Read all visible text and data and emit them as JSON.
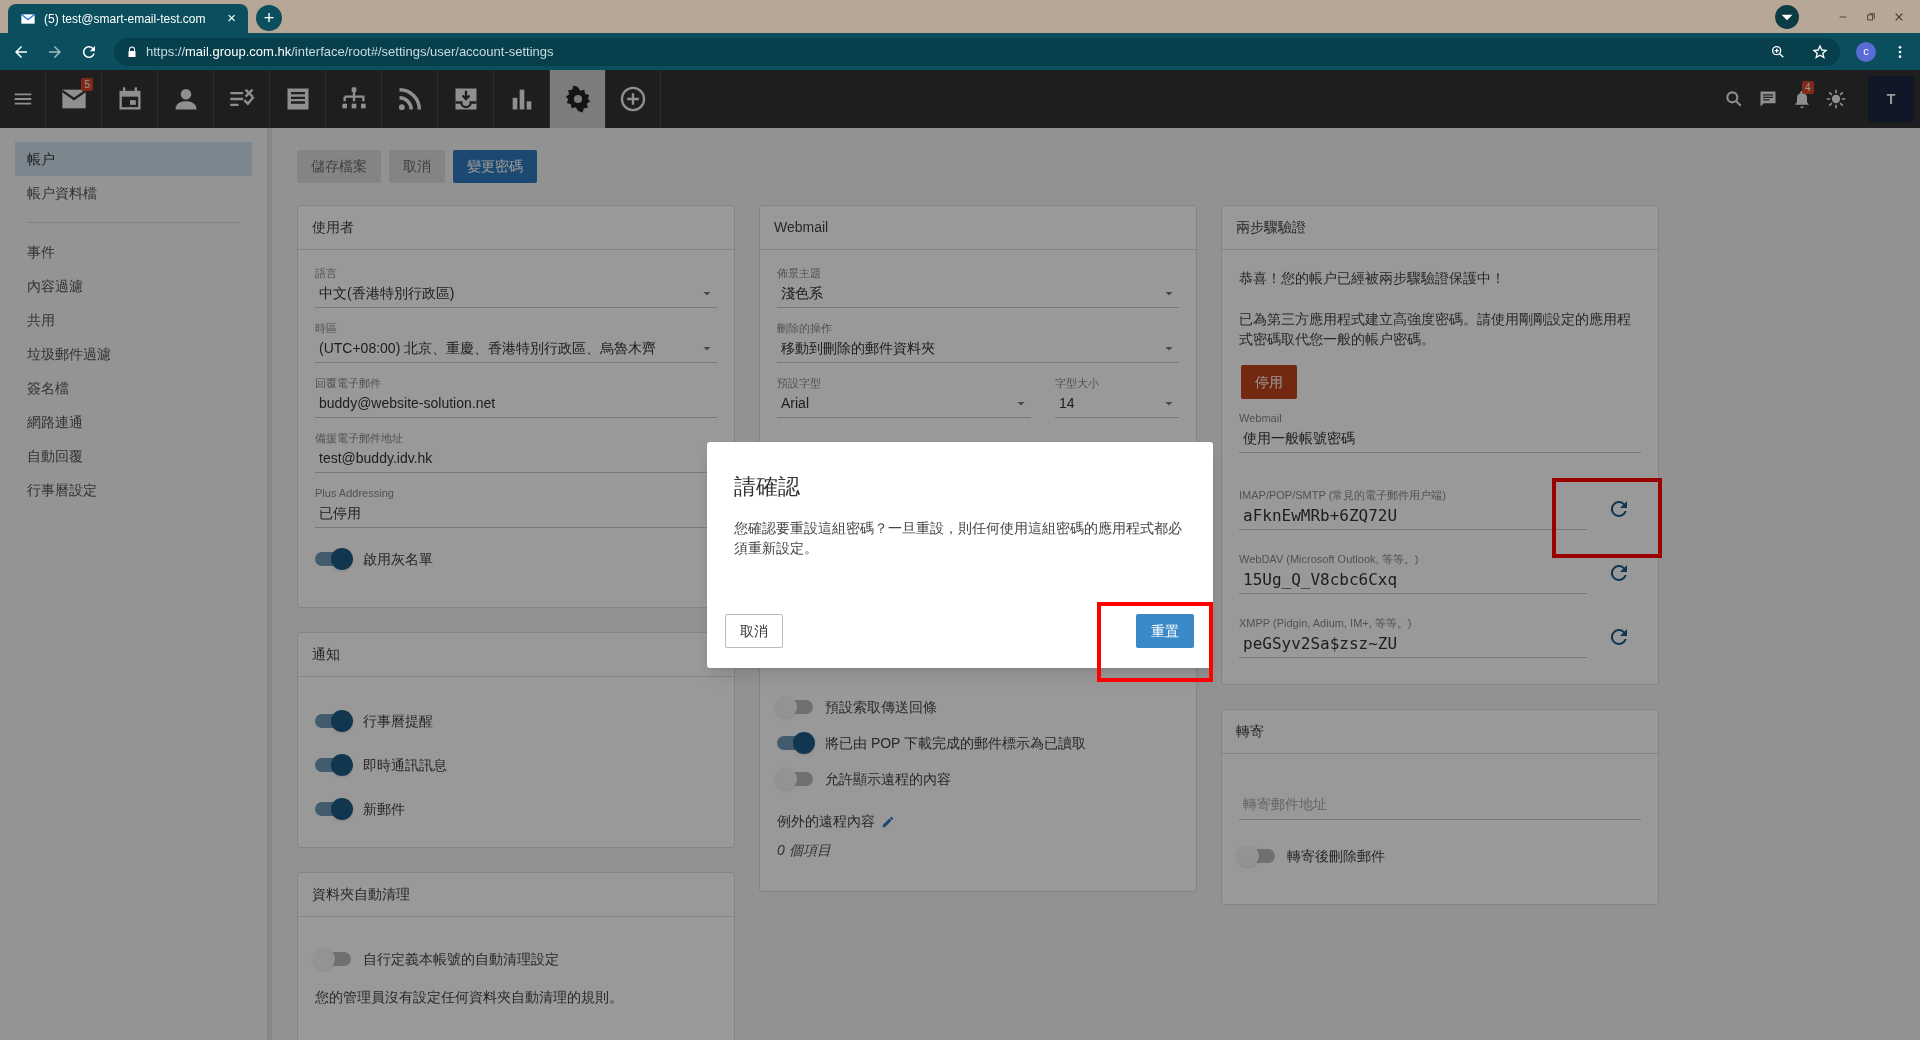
{
  "browser": {
    "tab_title": "(5) test@smart-email-test.com",
    "tab_close": "×",
    "new_tab": "+",
    "url_scheme": "https://",
    "url_host": "mail.group.com.hk",
    "url_path": "/interface/root#/settings/user/account-settings",
    "profile": "c"
  },
  "toolbar": {
    "apps": [
      {
        "kind": "mail",
        "selected": false,
        "badge": "5"
      },
      {
        "kind": "calendar",
        "selected": false
      },
      {
        "kind": "contacts",
        "selected": false
      },
      {
        "kind": "tasks",
        "selected": false
      },
      {
        "kind": "notes",
        "selected": false
      },
      {
        "kind": "org",
        "selected": false
      },
      {
        "kind": "rss",
        "selected": false
      },
      {
        "kind": "archive",
        "selected": false
      },
      {
        "kind": "reports",
        "selected": false
      },
      {
        "kind": "settings",
        "selected": true
      },
      {
        "kind": "add",
        "selected": false
      }
    ],
    "notifications_badge": "4",
    "avatar": "T"
  },
  "sidebar": {
    "groups": [
      [
        {
          "label": "帳户",
          "selected": true
        },
        {
          "label": "帳户資料檔",
          "selected": false
        }
      ],
      [
        {
          "label": "事件",
          "selected": false
        },
        {
          "label": "內容過濾",
          "selected": false
        },
        {
          "label": "共用",
          "selected": false
        },
        {
          "label": "垃圾郵件過濾",
          "selected": false
        },
        {
          "label": "簽名檔",
          "selected": false
        },
        {
          "label": "網路連通",
          "selected": false
        },
        {
          "label": "自動回覆",
          "selected": false
        },
        {
          "label": "行事曆設定",
          "selected": false
        }
      ]
    ]
  },
  "actions": [
    {
      "label": "儲存檔案",
      "disabled": true
    },
    {
      "label": "取消",
      "disabled": true
    },
    {
      "label": "變更密碼",
      "disabled": false
    }
  ],
  "user_card": {
    "title": "使用者",
    "fields": [
      {
        "kind": "select",
        "label": "語言",
        "value": "中文(香港特別行政區)"
      },
      {
        "kind": "select",
        "label": "時區",
        "value": "(UTC+08:00) 北京、重慶、香港特別行政區、烏魯木齊"
      },
      {
        "kind": "text",
        "label": "回覆電子郵件",
        "value": "buddy@website-solution.net"
      },
      {
        "kind": "text",
        "label": "備援電子郵件地址",
        "value": "test@buddy.idv.hk"
      },
      {
        "kind": "text",
        "label": "Plus Addressing",
        "value": "已停用"
      }
    ],
    "toggles": [
      {
        "label": "啟用灰名單",
        "on": true
      }
    ]
  },
  "notify_card": {
    "title": "通知",
    "toggles": [
      {
        "label": "行事曆提醒",
        "on": true
      },
      {
        "label": "即時通訊訊息",
        "on": true
      },
      {
        "label": "新郵件",
        "on": true
      }
    ]
  },
  "cleanup_card": {
    "title": "資料夾自動清理",
    "toggles": [
      {
        "label": "自行定義本帳號的自動清理設定",
        "on": false
      }
    ],
    "note": "您的管理員沒有設定任何資料夾自動清理的規則。"
  },
  "webmail_card": {
    "title": "Webmail",
    "fields": [
      {
        "label": "佈景主題",
        "value": "淺色系"
      },
      {
        "label": "刪除的操作",
        "value": "移動到刪除的郵件資料夾"
      }
    ],
    "font": {
      "label": "預設字型",
      "value": "Arial"
    },
    "size": {
      "label": "字型大小",
      "value": "14"
    },
    "toggles": [
      {
        "label": "預設索取傳送回條",
        "on": false
      },
      {
        "label": "將已由 POP 下載完成的郵件標示為已讀取",
        "on": true
      },
      {
        "label": "允許顯示遠程的內容",
        "on": false
      }
    ],
    "exceptions_label": "例外的遠程內容",
    "exceptions_count": "0 個項目"
  },
  "twofa_card": {
    "title": "兩步驟驗證",
    "message": "恭喜！您的帳户已經被兩步驟驗證保護中！",
    "info": "已為第三方應用程式建立高強度密碼。請使用剛剛設定的應用程式密碼取代您一般的帳户密碼。",
    "disable_button": "停用",
    "webmail": {
      "label": "Webmail",
      "value": "使用一般帳號密碼"
    },
    "passwords": [
      {
        "label": "IMAP/POP/SMTP (常見的電子郵件用户端)",
        "value": "aFknEwMRb+6ZQ72U",
        "highlighted": true
      },
      {
        "label": "WebDAV (Microsoft Outlook, 等等。)",
        "value": "15Ug_Q_V8cbc6Cxq",
        "highlighted": false
      },
      {
        "label": "XMPP (Pidgin, Adium, IM+, 等等。)",
        "value": "peGSyv2Sa$zsz~ZU",
        "highlighted": false
      }
    ]
  },
  "forward_card": {
    "title": "轉寄",
    "placeholder": "轉寄郵件地址",
    "toggles": [
      {
        "label": "轉寄後刪除郵件",
        "on": false
      }
    ]
  },
  "dialog": {
    "title": "請確認",
    "message": "您確認要重設這組密碼？一旦重設，則任何使用這組密碼的應用程式都必須重新設定。",
    "cancel": "取消",
    "confirm": "重置",
    "confirm_highlighted": true
  }
}
